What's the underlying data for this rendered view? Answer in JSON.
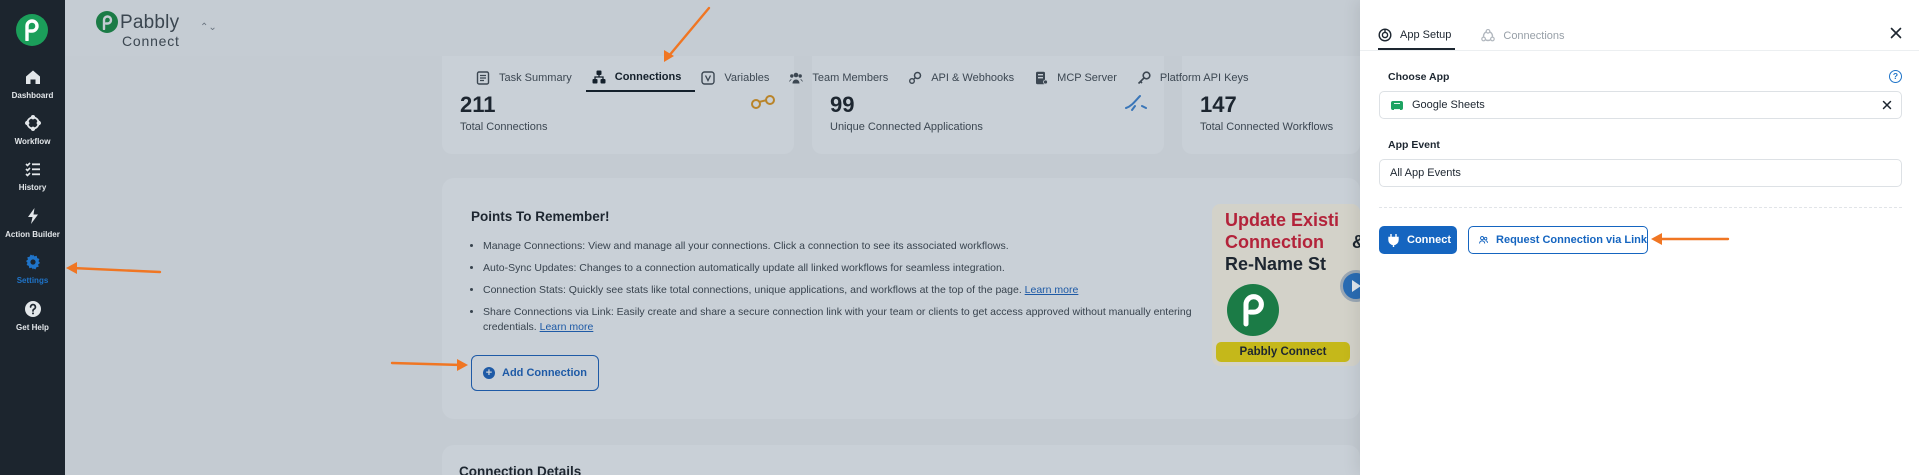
{
  "sidebar": {
    "items": [
      {
        "label": "Dashboard",
        "icon": "home-icon"
      },
      {
        "label": "Workflow",
        "icon": "workflow-icon"
      },
      {
        "label": "History",
        "icon": "history-icon"
      },
      {
        "label": "Action Builder",
        "icon": "bolt-icon"
      },
      {
        "label": "Settings",
        "icon": "gear-icon",
        "active": true
      },
      {
        "label": "Get Help",
        "icon": "help-circle-icon"
      }
    ]
  },
  "header": {
    "logo_word1": "Pabbly",
    "logo_word2": "Connect",
    "switcher": "⌃⌄"
  },
  "tabs": [
    {
      "label": "Task Summary",
      "icon": "task-summary-icon"
    },
    {
      "label": "Connections",
      "icon": "connections-icon",
      "active": true
    },
    {
      "label": "Variables",
      "icon": "variables-icon"
    },
    {
      "label": "Team Members",
      "icon": "team-members-icon"
    },
    {
      "label": "API & Webhooks",
      "icon": "api-webhooks-icon"
    },
    {
      "label": "MCP Server",
      "icon": "mcp-server-icon"
    },
    {
      "label": "Platform API Keys",
      "icon": "key-icon"
    }
  ],
  "stats": [
    {
      "value": "211",
      "label": "Total Connections"
    },
    {
      "value": "99",
      "label": "Unique Connected Applications"
    },
    {
      "value": "147",
      "label": "Total Connected Workflows"
    }
  ],
  "remember": {
    "title": "Points To Remember!",
    "items": [
      {
        "text": "Manage Connections: View and manage all your connections. Click a connection to see its associated workflows.",
        "link": ""
      },
      {
        "text": "Auto-Sync Updates: Changes to a connection automatically update all linked workflows for seamless integration.",
        "link": ""
      },
      {
        "text": "Connection Stats: Quickly see stats like total connections, unique applications, and workflows at the top of the page.",
        "link": "Learn more"
      },
      {
        "text": "Share Connections via Link: Easily create and share a secure connection link with your team or clients to get access approved without manually entering credentials.",
        "link": "Learn more"
      }
    ],
    "add_button": "Add Connection",
    "thumbnail": {
      "line1": "Update Existi",
      "line2": "Connection",
      "amp": "&",
      "line3": "Re-Name St",
      "banner": "Pabbly Connect"
    }
  },
  "details_title": "Connection Details",
  "drawer": {
    "tabs": [
      {
        "label": "App Setup",
        "active": true
      },
      {
        "label": "Connections",
        "active": false
      }
    ],
    "choose_app_label": "Choose App",
    "choose_app_value": "Google Sheets",
    "app_event_label": "App Event",
    "app_event_value": "All App Events",
    "connect_button": "Connect",
    "request_button": "Request Connection via Link",
    "help_glyph": "?"
  },
  "colors": {
    "accent": "#1565c0",
    "brand_green": "#1b9e5a",
    "annotation_arrow": "#f07623",
    "sidebar_bg": "#1c252e"
  }
}
